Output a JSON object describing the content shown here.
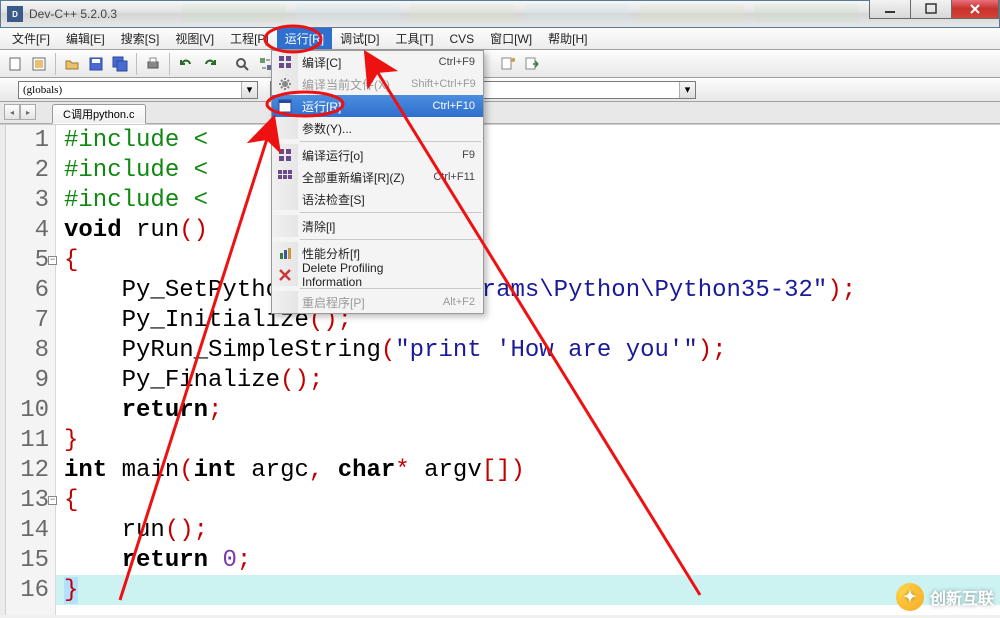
{
  "title": "Dev-C++ 5.2.0.3",
  "menus": [
    "文件[F]",
    "编辑[E]",
    "搜索[S]",
    "视图[V]",
    "工程[P]",
    "运行[R]",
    "调试[D]",
    "工具[T]",
    "CVS",
    "窗口[W]",
    "帮助[H]"
  ],
  "activeMenuIndex": 5,
  "globals_combo": "(globals)",
  "file_tab": "C调用python.c",
  "dropdown": {
    "items": [
      {
        "icon": "grid",
        "label": "编译[C]",
        "shortcut": "Ctrl+F9",
        "disabled": false
      },
      {
        "icon": "cog",
        "label": "编译当前文件(X)",
        "shortcut": "Shift+Ctrl+F9",
        "disabled": true
      },
      {
        "icon": "window",
        "label": "运行[R]",
        "shortcut": "Ctrl+F10",
        "disabled": false,
        "selected": true
      },
      {
        "icon": "",
        "label": "参数(Y)...",
        "shortcut": "",
        "disabled": false
      },
      {
        "sep": true
      },
      {
        "icon": "grid",
        "label": "编译运行[o]",
        "shortcut": "F9",
        "disabled": false
      },
      {
        "icon": "grid2",
        "label": "全部重新编译[R](Z)",
        "shortcut": "Ctrl+F11",
        "disabled": false
      },
      {
        "icon": "",
        "label": "语法检查[S]",
        "shortcut": "",
        "disabled": false
      },
      {
        "sep": true
      },
      {
        "icon": "",
        "label": "清除[l]",
        "shortcut": "",
        "disabled": false
      },
      {
        "sep": true
      },
      {
        "icon": "chart",
        "label": "性能分析[f]",
        "shortcut": "",
        "disabled": false
      },
      {
        "icon": "xred",
        "label": "Delete Profiling Information",
        "shortcut": "",
        "disabled": false
      },
      {
        "sep": true
      },
      {
        "icon": "",
        "label": "重启程序[P]",
        "shortcut": "Alt+F2",
        "disabled": true
      }
    ]
  },
  "code_lines": [
    {
      "n": "1",
      "tokens": [
        {
          "c": "pp",
          "t": "#include <"
        }
      ]
    },
    {
      "n": "2",
      "tokens": [
        {
          "c": "pp",
          "t": "#include <"
        }
      ]
    },
    {
      "n": "3",
      "tokens": [
        {
          "c": "pp",
          "t": "#include <"
        }
      ]
    },
    {
      "n": "4",
      "tokens": [
        {
          "c": "kw",
          "t": "void"
        },
        {
          "c": "txt",
          "t": " run"
        },
        {
          "c": "brace",
          "t": "()"
        }
      ]
    },
    {
      "n": "5",
      "fold": true,
      "tokens": [
        {
          "c": "brace",
          "t": "{"
        }
      ]
    },
    {
      "n": "6",
      "tokens": [
        {
          "c": "txt",
          "t": "    Py_SetPythonHome"
        },
        {
          "c": "brace",
          "t": "("
        },
        {
          "c": "str",
          "t": "\"C:\\Programs\\Python\\Python35-32\""
        },
        {
          "c": "brace",
          "t": ")"
        },
        {
          "c": "op",
          "t": ";"
        }
      ]
    },
    {
      "n": "7",
      "tokens": [
        {
          "c": "txt",
          "t": "    Py_Initialize"
        },
        {
          "c": "brace",
          "t": "()"
        },
        {
          "c": "op",
          "t": ";"
        }
      ]
    },
    {
      "n": "8",
      "tokens": [
        {
          "c": "txt",
          "t": "    PyRun_SimpleString"
        },
        {
          "c": "brace",
          "t": "("
        },
        {
          "c": "str",
          "t": "\"print 'How are you'\""
        },
        {
          "c": "brace",
          "t": ")"
        },
        {
          "c": "op",
          "t": ";"
        }
      ]
    },
    {
      "n": "9",
      "tokens": [
        {
          "c": "txt",
          "t": "    Py_Finalize"
        },
        {
          "c": "brace",
          "t": "()"
        },
        {
          "c": "op",
          "t": ";"
        }
      ]
    },
    {
      "n": "10",
      "tokens": [
        {
          "c": "txt",
          "t": "    "
        },
        {
          "c": "kw",
          "t": "return"
        },
        {
          "c": "op",
          "t": ";"
        }
      ]
    },
    {
      "n": "11",
      "tokens": [
        {
          "c": "brace",
          "t": "}"
        }
      ]
    },
    {
      "n": "12",
      "tokens": [
        {
          "c": "kw",
          "t": "int"
        },
        {
          "c": "txt",
          "t": " main"
        },
        {
          "c": "brace",
          "t": "("
        },
        {
          "c": "kw",
          "t": "int"
        },
        {
          "c": "txt",
          "t": " argc"
        },
        {
          "c": "op",
          "t": ","
        },
        {
          "c": "txt",
          "t": " "
        },
        {
          "c": "kw",
          "t": "char"
        },
        {
          "c": "star",
          "t": "*"
        },
        {
          "c": "txt",
          "t": " argv"
        },
        {
          "c": "brace",
          "t": "[])"
        }
      ]
    },
    {
      "n": "13",
      "fold": true,
      "tokens": [
        {
          "c": "brace",
          "t": "{"
        }
      ]
    },
    {
      "n": "14",
      "tokens": [
        {
          "c": "txt",
          "t": "    run"
        },
        {
          "c": "brace",
          "t": "()"
        },
        {
          "c": "op",
          "t": ";"
        }
      ]
    },
    {
      "n": "15",
      "tokens": [
        {
          "c": "txt",
          "t": "    "
        },
        {
          "c": "kw",
          "t": "return"
        },
        {
          "c": "txt",
          "t": " "
        },
        {
          "c": "num",
          "t": "0"
        },
        {
          "c": "op",
          "t": ";"
        }
      ]
    },
    {
      "n": "16",
      "cursor": true,
      "tokens": [
        {
          "c": "cursor-brace",
          "t": "}"
        }
      ]
    }
  ],
  "watermark": "创新互联"
}
